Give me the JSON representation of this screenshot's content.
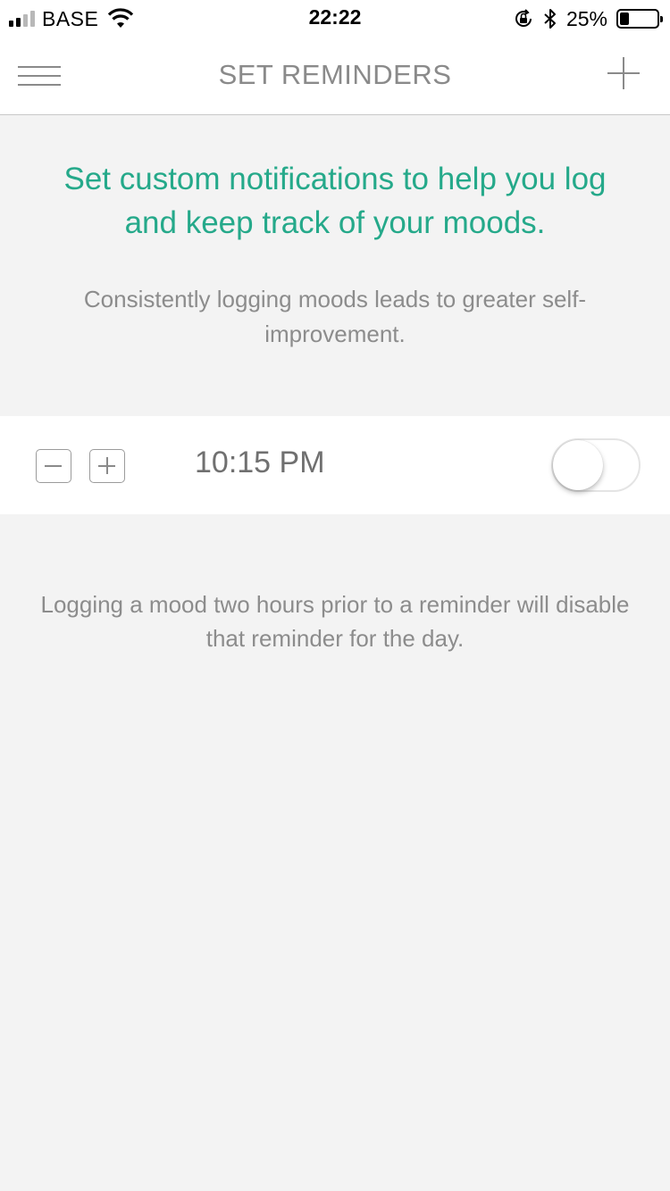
{
  "status_bar": {
    "carrier": "BASE",
    "time": "22:22",
    "battery_percent": "25%",
    "battery_level": 0.25,
    "signal_bars_active": 2,
    "signal_bars_total": 4
  },
  "nav": {
    "title": "SET REMINDERS",
    "menu_icon": "hamburger-menu-icon",
    "add_icon": "plus-icon"
  },
  "intro": {
    "headline": "Set custom notifications to help you log and keep track of your moods.",
    "subtext": "Consistently logging moods leads to greater self-improvement."
  },
  "reminders": [
    {
      "time": "10:15 PM",
      "enabled": false
    }
  ],
  "footnote": "Logging a mood two hours prior to a reminder will disable that reminder for the day.",
  "colors": {
    "accent": "#25a98a",
    "background": "#f3f3f3",
    "muted_text": "#8c8c8c"
  }
}
